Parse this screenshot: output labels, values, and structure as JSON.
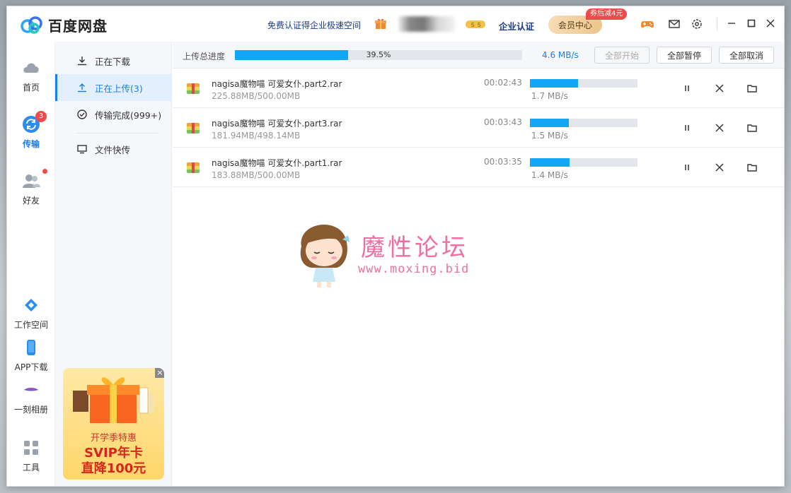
{
  "app": {
    "title": "百度网盘"
  },
  "header": {
    "promo_link": "免费认证得企业极速空间",
    "enterprise_link": "企业认证",
    "vip_button": "会员中心",
    "vip_badge": "券后减4元"
  },
  "rail": {
    "items": [
      {
        "label": "首页"
      },
      {
        "label": "传输",
        "badge": "3"
      },
      {
        "label": "好友"
      },
      {
        "label": "工作空间"
      },
      {
        "label": "APP下载"
      },
      {
        "label": "一刻相册"
      },
      {
        "label": "工具"
      }
    ]
  },
  "subnav": {
    "items": [
      {
        "label": "正在下载"
      },
      {
        "label": "正在上传(3)"
      },
      {
        "label": "传输完成(999+)"
      },
      {
        "label": "文件快传"
      }
    ]
  },
  "ad": {
    "close": "×",
    "line1": "开学季特惠",
    "line2": "SVIP年卡",
    "line3": "直降100元"
  },
  "toolbar": {
    "label": "上传总进度",
    "progress_text": "39.5%",
    "progress": 0.395,
    "speed": "4.6 MB/s",
    "start_all": "全部开始",
    "pause_all": "全部暂停",
    "cancel_all": "全部取消"
  },
  "uploads": [
    {
      "name": "nagisa魔物喵 可爱女仆.part2.rar",
      "size": "225.88MB/500.00MB",
      "time": "00:02:43",
      "speed": "1.7 MB/s",
      "progress": 0.45
    },
    {
      "name": "nagisa魔物喵 可爱女仆.part3.rar",
      "size": "181.94MB/498.14MB",
      "time": "00:03:43",
      "speed": "1.5 MB/s",
      "progress": 0.36
    },
    {
      "name": "nagisa魔物喵 可爱女仆.part1.rar",
      "size": "183.88MB/500.00MB",
      "time": "00:03:35",
      "speed": "1.4 MB/s",
      "progress": 0.37
    }
  ],
  "watermark": {
    "title": "魔性论坛",
    "url": "www.moxing.bid"
  },
  "colors": {
    "accent": "#1c7ef0",
    "progress": "#11a7f5",
    "badge": "#f04a4a"
  }
}
